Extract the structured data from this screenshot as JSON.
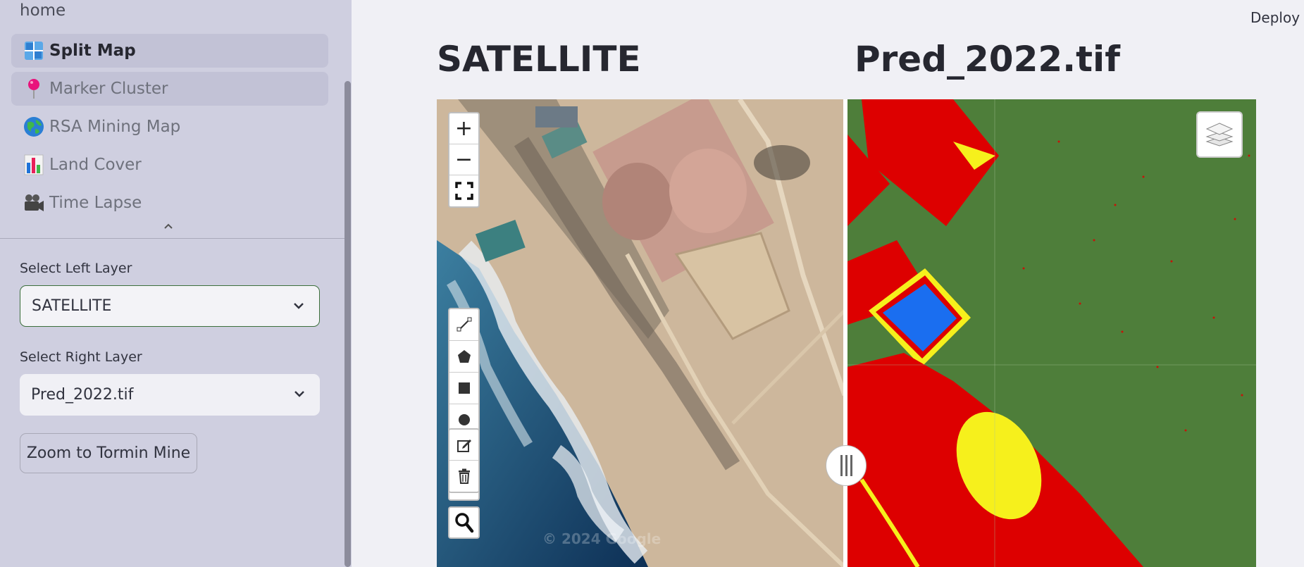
{
  "sidebar": {
    "home_label": "home",
    "items": [
      {
        "label": "Split Map",
        "icon": "split-map-icon"
      },
      {
        "label": "Marker Cluster",
        "icon": "pin-icon"
      },
      {
        "label": "RSA Mining Map",
        "icon": "globe-icon"
      },
      {
        "label": "Land Cover",
        "icon": "bar-chart-icon"
      },
      {
        "label": "Time Lapse",
        "icon": "camera-icon"
      }
    ],
    "left_layer_label": "Select Left Layer",
    "left_layer_value": "SATELLITE",
    "right_layer_label": "Select Right Layer",
    "right_layer_value": "Pred_2022.tif",
    "zoom_button_label": "Zoom to Tormin Mine"
  },
  "header": {
    "deploy_label": "Deploy"
  },
  "map": {
    "left_title": "SATELLITE",
    "right_title": "Pred_2022.tif",
    "attribution": "© 2024 Google",
    "zoom_in": "+",
    "zoom_out": "−",
    "class_colors": {
      "vegetation": "#4e7e3a",
      "mining": "#dd0000",
      "water": "#1a6ef0",
      "sand": "#f6f01c"
    }
  }
}
